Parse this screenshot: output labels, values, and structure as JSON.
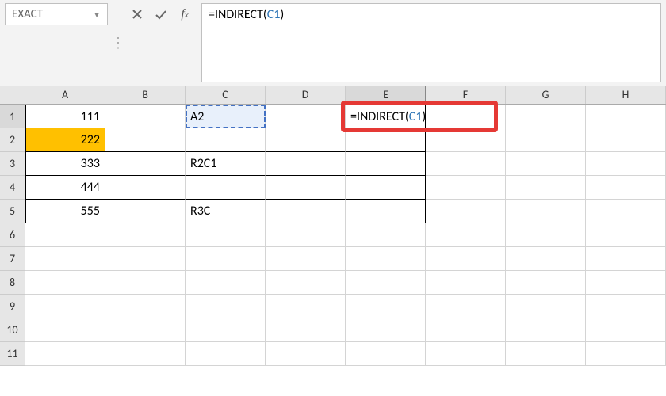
{
  "name_box": "EXACT",
  "formula_bar": {
    "prefix": "=INDIRECT(",
    "ref": "C1",
    "suffix": ")"
  },
  "columns": [
    "A",
    "B",
    "C",
    "D",
    "E",
    "F",
    "G",
    "H"
  ],
  "rows_visible": 11,
  "cells": {
    "A1": "111",
    "A2": "222",
    "A3": "333",
    "A4": "444",
    "A5": "555",
    "C1": "A2",
    "C3": "R2C1",
    "C5": "R3C",
    "E1_prefix": "=INDIRECT(",
    "E1_ref": "C1",
    "E1_suffix": ")"
  },
  "chart_data": {
    "type": "table",
    "active_cell": "E1",
    "referenced_cell": "C1",
    "data": [
      {
        "row": 1,
        "A": 111,
        "C": "A2",
        "E": "=INDIRECT(C1)"
      },
      {
        "row": 2,
        "A": 222
      },
      {
        "row": 3,
        "A": 333,
        "C": "R2C1"
      },
      {
        "row": 4,
        "A": 444
      },
      {
        "row": 5,
        "A": 555,
        "C": "R3C"
      }
    ]
  }
}
